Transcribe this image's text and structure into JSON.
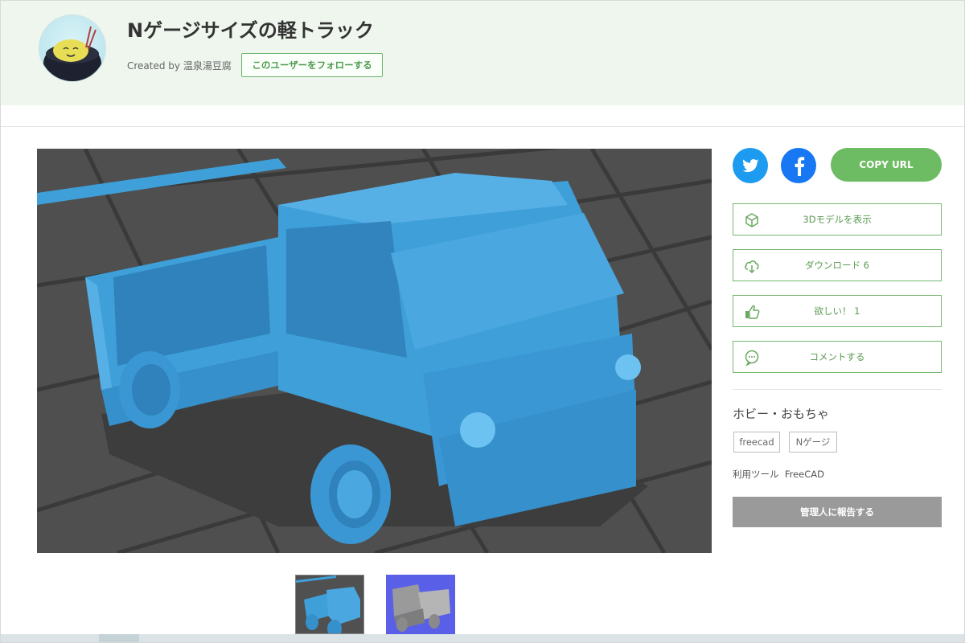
{
  "header": {
    "title": "Nゲージサイズの軽トラック",
    "created_prefix": "Created by",
    "author": "温泉湯豆腐",
    "follow_label": "このユーザーをフォローする"
  },
  "share": {
    "twitter_icon": "twitter-bird-icon",
    "facebook_icon": "facebook-f-icon",
    "copy_url_label": "COPY URL"
  },
  "actions": [
    {
      "label": "3Dモデルを表示",
      "icon": "cube-icon"
    },
    {
      "label": "ダウンロード 6",
      "icon": "cloud-download-icon"
    },
    {
      "label": "欲しい！ 1",
      "icon": "thumbs-up-icon"
    },
    {
      "label": "コメントする",
      "icon": "speech-bubble-icon"
    }
  ],
  "category": "ホビー・おもちゃ",
  "tags": [
    "freecad",
    "Nゲージ"
  ],
  "tool": {
    "label": "利用ツール",
    "value": "FreeCAD"
  },
  "report_label": "管理人に報告する",
  "colors": {
    "accent": "#6dbb62",
    "header_bg": "#eef6ee",
    "model_blue": "#3f9fd8",
    "viewer_bg": "#4f4f4f"
  }
}
